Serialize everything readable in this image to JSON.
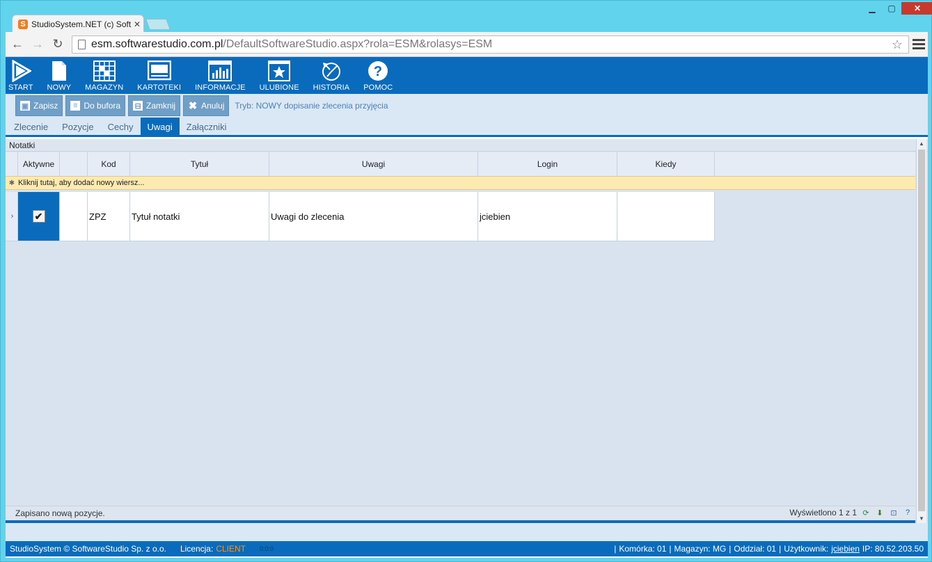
{
  "browser": {
    "tab_title": "StudioSystem.NET (c) Soft",
    "url_host": "esm.softwarestudio.com.pl",
    "url_path": "/DefaultSoftwareStudio.aspx?rola=ESM&rolasys=ESM"
  },
  "topnav": [
    {
      "label": "START",
      "icon": "play-icon"
    },
    {
      "label": "NOWY",
      "icon": "document-icon"
    },
    {
      "label": "MAGAZYN",
      "icon": "warehouse-grid-icon"
    },
    {
      "label": "KARTOTEKI",
      "icon": "card-file-icon"
    },
    {
      "label": "INFORMACJE",
      "icon": "chart-icon"
    },
    {
      "label": "ULUBIONE",
      "icon": "star-icon"
    },
    {
      "label": "HISTORIA",
      "icon": "history-icon"
    },
    {
      "label": "POMOC",
      "icon": "help-icon"
    }
  ],
  "actions": {
    "save": "Zapisz",
    "to_buffer": "Do bufora",
    "close": "Zamknij",
    "cancel": "Anuluj",
    "mode": "Tryb: NOWY dopisanie zlecenia przyjęcia"
  },
  "tabs": [
    "Zlecenie",
    "Pozycje",
    "Cechy",
    "Uwagi",
    "Załączniki"
  ],
  "active_tab": "Uwagi",
  "panel": {
    "title": "Notatki",
    "columns": [
      "Aktywne",
      "",
      "Kod",
      "Tytuł",
      "Uwagi",
      "Login",
      "Kiedy"
    ],
    "add_row_text": "Kliknij tutaj, aby dodać nowy wiersz...",
    "rows": [
      {
        "aktywne": true,
        "kod": "ZPZ",
        "tytul": "Tytuł notatki",
        "uwagi": "Uwagi do zlecenia",
        "login": "jciebien",
        "kiedy": ""
      }
    ]
  },
  "status": {
    "message": "Zapisano nową pozycje.",
    "shown": "Wyświetlono 1 z 1"
  },
  "footer": {
    "copyright": "StudioSystem © SoftwareStudio Sp. z o.o.",
    "license_label": "Licencja:",
    "license_value": "CLIENT",
    "version": "0:0:0",
    "komorka": "Komórka: 01",
    "magazyn": "Magazyn: MG",
    "oddzial": "Oddział: 01",
    "user_label": "Użytkownik:",
    "user": "jciebien",
    "ip": "IP: 80.52.203.50"
  },
  "colors": {
    "brand": "#0a6bbd",
    "accent_orange": "#f7931e",
    "add_row": "#fdeab0"
  }
}
